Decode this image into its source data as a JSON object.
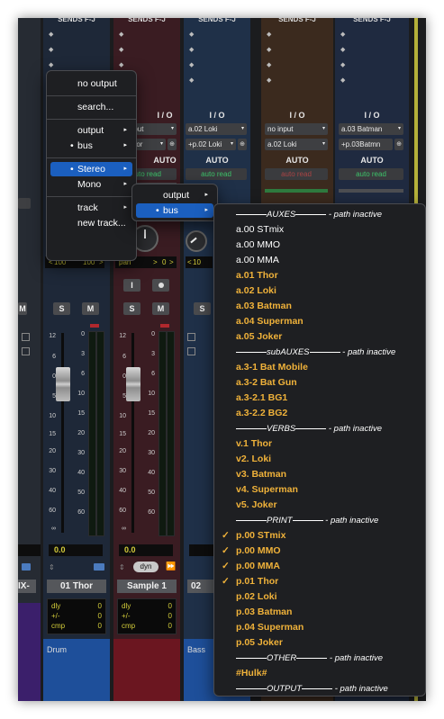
{
  "sends_header": "SENDS F-J",
  "strips": [
    {
      "io_label": "I / O",
      "auto_label": "AUTO",
      "name": "01 Thor",
      "comment": "Drum",
      "volume": "0.0",
      "delay": [
        {
          "k": "dly",
          "v": "0"
        },
        {
          "k": "+/-",
          "v": "0"
        },
        {
          "k": "cmp",
          "v": "0"
        }
      ],
      "pan_left": "100",
      "pan_right": "100",
      "solo": "S",
      "mute": "M"
    },
    {
      "io_label": "I / O",
      "auto_label": "AUTO",
      "input": "no input",
      "output": "01 Thor",
      "automation": "auto read",
      "name": "Sample 1",
      "volume": "0.0",
      "pan": "pan",
      "pan_value": "0",
      "dyn": "dyn",
      "delay": [
        {
          "k": "dly",
          "v": "0"
        },
        {
          "k": "+/-",
          "v": "0"
        },
        {
          "k": "cmp",
          "v": "0"
        }
      ],
      "solo": "S",
      "mute": "M",
      "input_btn": "I"
    },
    {
      "io_label": "I / O",
      "auto_label": "AUTO",
      "input": "a.02 Loki",
      "output": "+p.02 Loki",
      "automation": "auto read",
      "name_partial": "02",
      "comment": "Bass",
      "pan_partial": "10",
      "solo": "S",
      "mute": "M"
    },
    {
      "io_label": "I / O",
      "auto_label": "AUTO",
      "input": "no input",
      "output": "a.02 Loki",
      "automation": "auto read"
    },
    {
      "io_label": "I / O",
      "auto_label": "AUTO",
      "input": "a.03 Batman",
      "output": "+p.03Batmn",
      "automation": "auto read"
    }
  ],
  "left_strip_name_partial": "IX-",
  "left_strip_mute": "M",
  "fader_scale": [
    "12",
    "6",
    "0",
    "5",
    "10",
    "15",
    "20",
    "30",
    "40",
    "60",
    "∞"
  ],
  "meter_scale": [
    "0",
    "3",
    "6",
    "10",
    "15",
    "20",
    "30",
    "40",
    "50",
    "60"
  ],
  "menu1": {
    "items": [
      {
        "label": "no output",
        "type": "item"
      },
      {
        "type": "sep"
      },
      {
        "label": "search...",
        "type": "item"
      },
      {
        "type": "sep"
      },
      {
        "label": "output",
        "type": "item",
        "arrow": true
      },
      {
        "label": "bus",
        "type": "item",
        "arrow": true,
        "bullet": true
      },
      {
        "type": "sep"
      },
      {
        "label": "Stereo",
        "type": "item",
        "arrow": true,
        "bullet": true,
        "highlight": true
      },
      {
        "label": "Mono",
        "type": "item",
        "arrow": true
      },
      {
        "type": "sep"
      },
      {
        "label": "track",
        "type": "item",
        "arrow": true
      },
      {
        "label": "new track...",
        "type": "item"
      }
    ]
  },
  "menu2": {
    "items": [
      {
        "label": "output",
        "arrow": true
      },
      {
        "label": "bus",
        "arrow": true,
        "bullet": true,
        "highlight": true
      }
    ]
  },
  "bus_menu": [
    {
      "type": "head",
      "label": "AUXES",
      "suffix": " - path inactive"
    },
    {
      "type": "item",
      "label": "a.00 STmix",
      "color": "white"
    },
    {
      "type": "item",
      "label": "a.00 MMO",
      "color": "white"
    },
    {
      "type": "item",
      "label": "a.00 MMA",
      "color": "white"
    },
    {
      "type": "item",
      "label": "a.01 Thor",
      "color": "orange"
    },
    {
      "type": "item",
      "label": "a.02 Loki",
      "color": "orange"
    },
    {
      "type": "item",
      "label": "a.03 Batman",
      "color": "orange"
    },
    {
      "type": "item",
      "label": "a.04 Superman",
      "color": "orange"
    },
    {
      "type": "item",
      "label": "a.05 Joker",
      "color": "orange"
    },
    {
      "type": "head",
      "label": "subAUXES",
      "suffix": " - path inactive"
    },
    {
      "type": "item",
      "label": "a.3-1 Bat Mobile",
      "color": "orange"
    },
    {
      "type": "item",
      "label": "a.3-2 Bat Gun",
      "color": "orange"
    },
    {
      "type": "item",
      "label": "a.3-2.1 BG1",
      "color": "orange"
    },
    {
      "type": "item",
      "label": "a.3-2.2 BG2",
      "color": "orange"
    },
    {
      "type": "head",
      "label": "VERBS",
      "suffix": " - path inactive"
    },
    {
      "type": "item",
      "label": "v.1 Thor",
      "color": "orange"
    },
    {
      "type": "item",
      "label": "v2. Loki",
      "color": "orange"
    },
    {
      "type": "item",
      "label": "v3. Batman",
      "color": "orange"
    },
    {
      "type": "item",
      "label": "v4. Superman",
      "color": "orange"
    },
    {
      "type": "item",
      "label": "v5. Joker",
      "color": "orange"
    },
    {
      "type": "head",
      "label": "PRINT",
      "suffix": " - path inactive"
    },
    {
      "type": "item",
      "label": "p.00 STmix",
      "color": "orange",
      "checked": true
    },
    {
      "type": "item",
      "label": "p.00 MMO",
      "color": "orange",
      "checked": true
    },
    {
      "type": "item",
      "label": "p.00 MMA",
      "color": "orange",
      "checked": true
    },
    {
      "type": "item",
      "label": "p.01 Thor",
      "color": "orange",
      "checked": true
    },
    {
      "type": "item",
      "label": "p.02 Loki",
      "color": "orange"
    },
    {
      "type": "item",
      "label": "p.03 Batman",
      "color": "orange"
    },
    {
      "type": "item",
      "label": "p.04 Superman",
      "color": "orange"
    },
    {
      "type": "item",
      "label": "p.05 Joker",
      "color": "orange"
    },
    {
      "type": "head",
      "label": "OTHER",
      "suffix": " - path inactive"
    },
    {
      "type": "item",
      "label": "#Hulk#",
      "color": "orange"
    },
    {
      "type": "head",
      "label": "OUTPUT",
      "suffix": " - path inactive"
    }
  ],
  "colors": {
    "strip_blue": "#1f3d63",
    "strip_red": "#4a1e24",
    "strip_blue2": "#20456e",
    "strip_brown": "#3d2a1c",
    "strip_navy": "#232c45",
    "orange_text": "#f0b23a",
    "highlight": "#1b5fbf",
    "auto_green": "#3dc46a"
  }
}
